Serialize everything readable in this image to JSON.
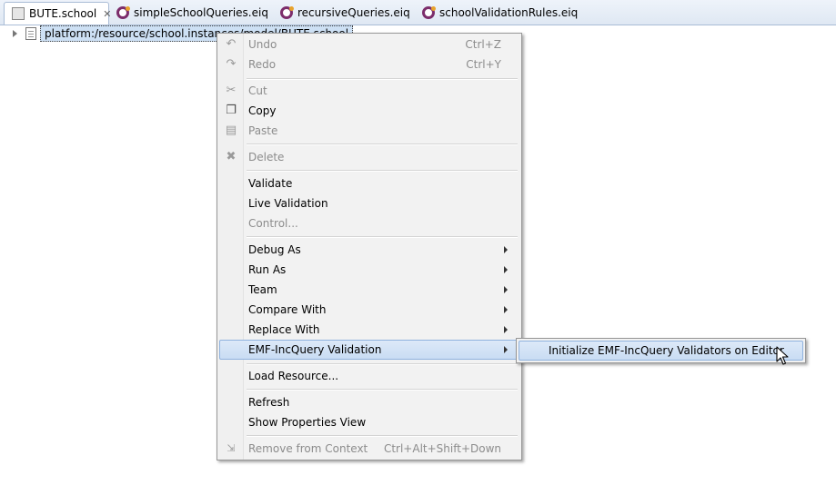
{
  "tabs": [
    {
      "label": "BUTE.school",
      "icon": "school-model-icon",
      "active": true
    },
    {
      "label": "simpleSchoolQueries.eiq",
      "icon": "eiq-file-icon",
      "active": false
    },
    {
      "label": "recursiveQueries.eiq",
      "icon": "eiq-file-icon",
      "active": false
    },
    {
      "label": "schoolValidationRules.eiq",
      "icon": "eiq-file-icon",
      "active": false
    }
  ],
  "tree": {
    "root_label": "platform:/resource/school.instances/model/BUTE.school"
  },
  "context_menu": {
    "items": [
      {
        "label": "Undo",
        "accel": "Ctrl+Z",
        "icon": "undo-icon",
        "disabled": true
      },
      {
        "label": "Redo",
        "accel": "Ctrl+Y",
        "icon": "redo-icon",
        "disabled": true
      },
      {
        "label": "Cut",
        "icon": "cut-icon",
        "disabled": true
      },
      {
        "label": "Copy",
        "icon": "copy-icon",
        "disabled": false
      },
      {
        "label": "Paste",
        "icon": "paste-icon",
        "disabled": true
      },
      {
        "label": "Delete",
        "icon": "delete-icon",
        "disabled": true
      },
      {
        "label": "Validate",
        "disabled": false
      },
      {
        "label": "Live Validation",
        "disabled": false
      },
      {
        "label": "Control...",
        "disabled": true
      },
      {
        "label": "Debug As",
        "submenu": true
      },
      {
        "label": "Run As",
        "submenu": true
      },
      {
        "label": "Team",
        "submenu": true
      },
      {
        "label": "Compare With",
        "submenu": true
      },
      {
        "label": "Replace With",
        "submenu": true
      },
      {
        "label": "EMF-IncQuery Validation",
        "submenu": true,
        "highlighted": true
      },
      {
        "label": "Load Resource...",
        "disabled": false
      },
      {
        "label": "Refresh",
        "disabled": false
      },
      {
        "label": "Show Properties View",
        "disabled": false
      },
      {
        "label": "Remove from Context",
        "accel": "Ctrl+Alt+Shift+Down",
        "icon": "remove-context-icon",
        "disabled": true
      }
    ]
  },
  "submenu": {
    "items": [
      {
        "label": "Initialize EMF-IncQuery Validators on Editor",
        "highlighted": true
      }
    ]
  }
}
